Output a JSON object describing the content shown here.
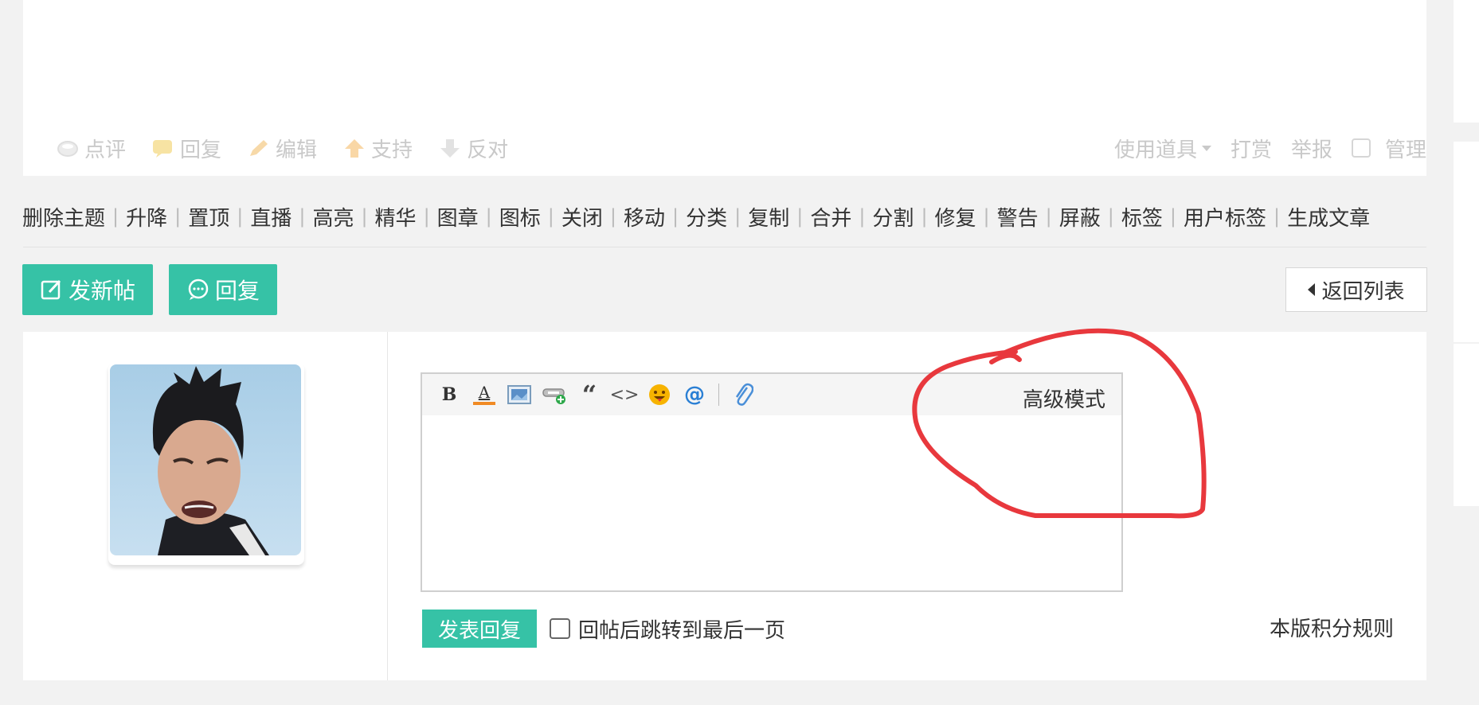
{
  "post_actions": {
    "comment": "点评",
    "reply": "回复",
    "edit": "编辑",
    "support": "支持",
    "oppose": "反对"
  },
  "post_tools": {
    "use_item": "使用道具",
    "reward": "打赏",
    "report": "举报",
    "manage": "管理"
  },
  "moderation_links": [
    "删除主题",
    "升降",
    "置顶",
    "直播",
    "高亮",
    "精华",
    "图章",
    "图标",
    "关闭",
    "移动",
    "分类",
    "复制",
    "合并",
    "分割",
    "修复",
    "警告",
    "屏蔽",
    "标签",
    "用户标签",
    "生成文章"
  ],
  "buttons": {
    "new_post": "发新帖",
    "reply": "回复",
    "back_to_list": "返回列表"
  },
  "editor": {
    "toolbar_icons": [
      "bold-icon",
      "font-color-icon",
      "image-icon",
      "link-icon",
      "quote-icon",
      "code-icon",
      "emoji-icon",
      "mention-icon",
      "attachment-icon"
    ],
    "bold_label": "B",
    "font_color_label": "A",
    "quote_label": "“",
    "code_label": "<>",
    "mention_label": "@",
    "advanced_mode": "高级模式"
  },
  "reply_form": {
    "submit": "发表回复",
    "jump_to_last": "回帖后跳转到最后一页",
    "credit_rules": "本版积分规则"
  },
  "colors": {
    "accent": "#36c2a6",
    "annotation": "#e8383d",
    "muted_text": "#c9c9c9"
  }
}
